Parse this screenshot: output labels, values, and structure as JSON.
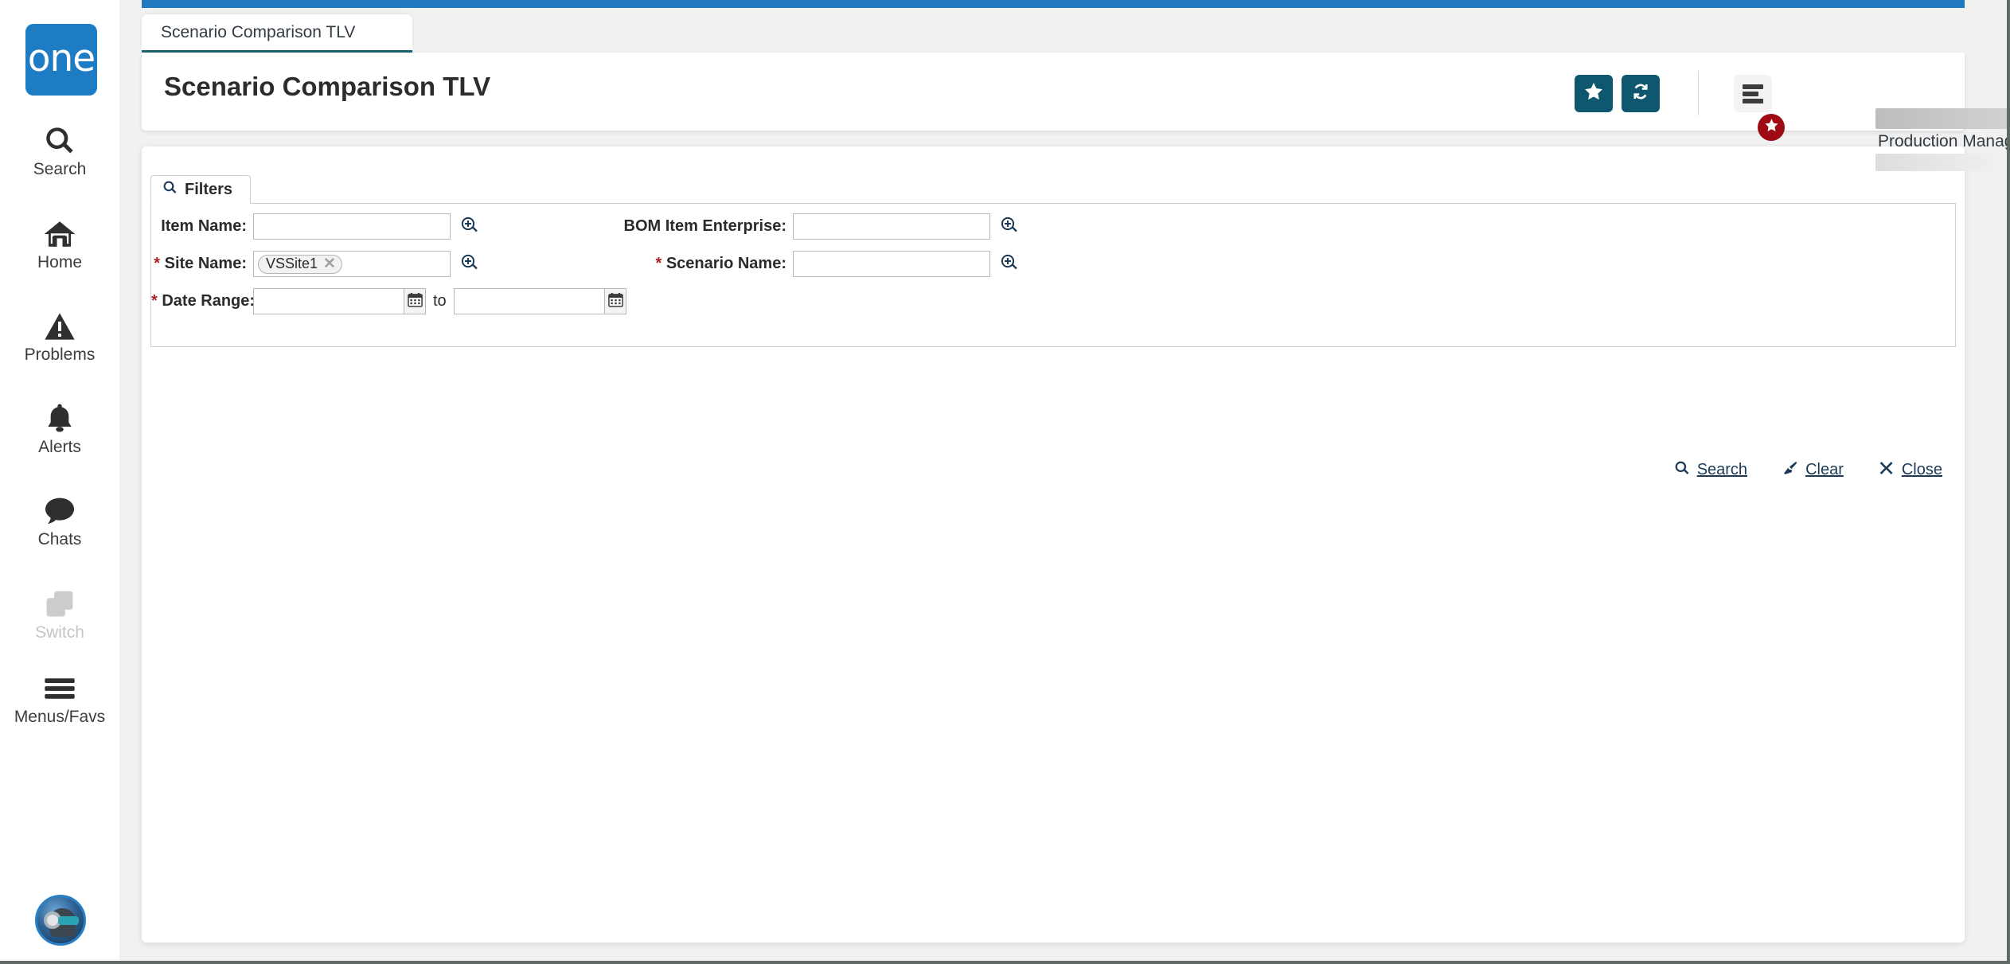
{
  "app": {
    "logo_text": "one",
    "brand_blue": "#1e7cc4",
    "accent_teal": "#0f576e",
    "badge_red": "#9e0b12"
  },
  "sidebar": {
    "items": [
      {
        "id": "search",
        "label": "Search",
        "icon": "search-icon",
        "disabled": false
      },
      {
        "id": "home",
        "label": "Home",
        "icon": "home-icon",
        "disabled": false
      },
      {
        "id": "problems",
        "label": "Problems",
        "icon": "warning-icon",
        "disabled": false
      },
      {
        "id": "alerts",
        "label": "Alerts",
        "icon": "bell-icon",
        "disabled": false
      },
      {
        "id": "chats",
        "label": "Chats",
        "icon": "chat-icon",
        "disabled": false
      },
      {
        "id": "switch",
        "label": "Switch",
        "icon": "switch-icon",
        "disabled": true
      },
      {
        "id": "menus",
        "label": "Menus/Favs",
        "icon": "hamburger-icon",
        "disabled": false
      }
    ],
    "avatar": "user-avatar"
  },
  "tabs": [
    {
      "label": "Scenario Comparison TLV",
      "active": true
    }
  ],
  "header": {
    "title": "Scenario Comparison TLV",
    "favorite_icon": "star-icon",
    "refresh_icon": "refresh-icon",
    "menu_icon": "list-menu-icon",
    "menu_badge_icon": "star-icon",
    "user_role": "Production Manager",
    "user_dropdown_icon": "chevron-down-icon"
  },
  "filters": {
    "tab_label": "Filters",
    "tab_icon": "search-icon",
    "fields": {
      "item_name": {
        "label": "Item Name:",
        "required": false,
        "value": "",
        "lookup_icon": "zoom-lookup-icon"
      },
      "site_name": {
        "label": "Site Name:",
        "required": true,
        "chips": [
          "VSSite1"
        ],
        "chip_remove_icon": "close-icon",
        "lookup_icon": "zoom-lookup-icon"
      },
      "date_range": {
        "label": "Date Range:",
        "required": true,
        "from_value": "",
        "to_value": "",
        "separator": "to",
        "calendar_icon": "calendar-icon"
      },
      "bom_item_enterprise": {
        "label": "BOM Item Enterprise:",
        "required": false,
        "value": "",
        "lookup_icon": "zoom-lookup-icon"
      },
      "scenario_name": {
        "label": "Scenario Name:",
        "required": true,
        "value": "",
        "lookup_icon": "zoom-lookup-icon"
      }
    },
    "actions": [
      {
        "id": "search",
        "label": "Search",
        "icon": "search-icon"
      },
      {
        "id": "clear",
        "label": "Clear",
        "icon": "broom-icon"
      },
      {
        "id": "close",
        "label": "Close",
        "icon": "close-icon"
      }
    ]
  }
}
